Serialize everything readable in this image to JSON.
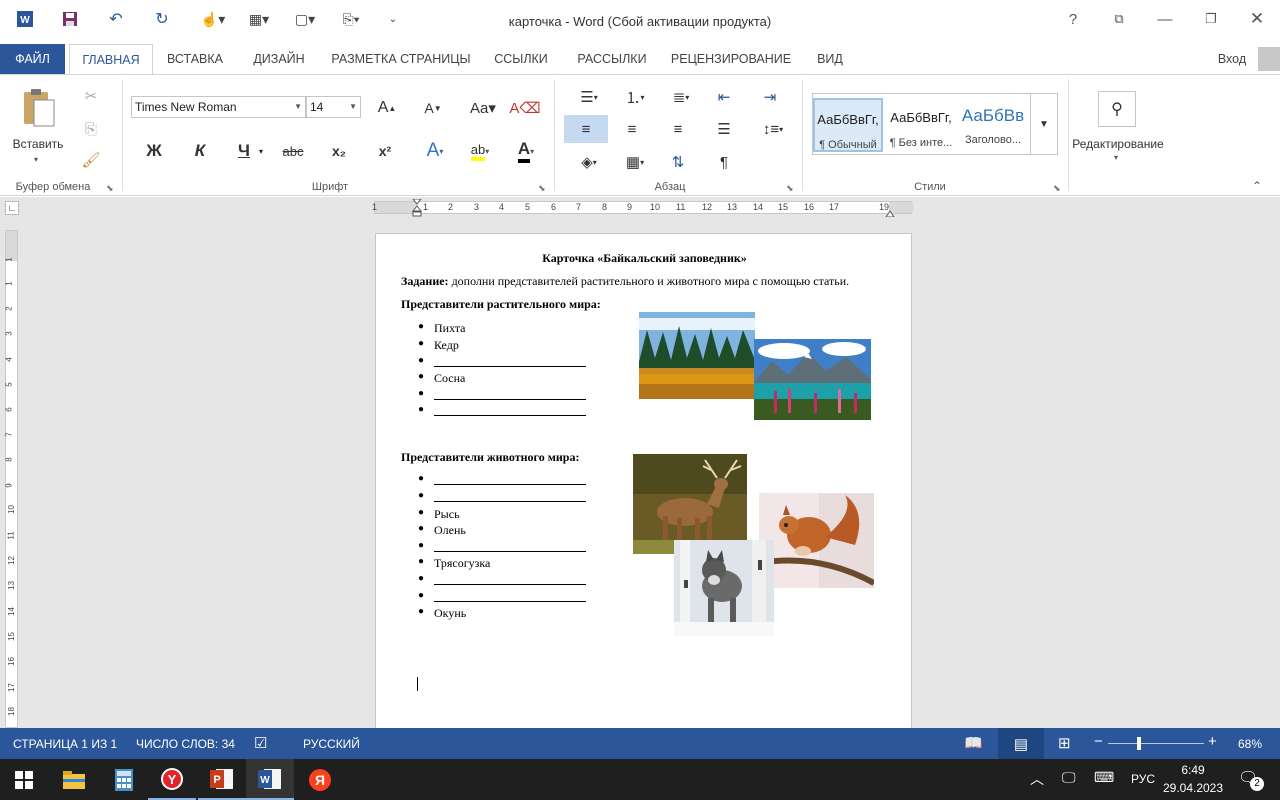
{
  "window": {
    "title": "карточка - Word (Сбой активации продукта)",
    "help": "?"
  },
  "tabs": {
    "file": "ФАЙЛ",
    "home": "ГЛАВНАЯ",
    "insert": "ВСТАВКА",
    "design": "ДИЗАЙН",
    "layout": "РАЗМЕТКА СТРАНИЦЫ",
    "references": "ССЫЛКИ",
    "mailings": "РАССЫЛКИ",
    "review": "РЕЦЕНЗИРОВАНИЕ",
    "view": "ВИД",
    "signin": "Вход"
  },
  "ribbon": {
    "paste_label": "Вставить",
    "clipboard_group": "Буфер обмена",
    "font_name": "Times New Roman",
    "font_size": "14",
    "font_group": "Шрифт",
    "bold": "Ж",
    "italic": "К",
    "underline": "Ч",
    "strike": "abc",
    "subscript": "x₂",
    "superscript": "x²",
    "paragraph_group": "Абзац",
    "styles_group": "Стили",
    "style_sample_1": "АаБбВвГг,",
    "style_name_1": "¶ Обычный",
    "style_sample_2": "АаБбВвГг,",
    "style_name_2": "¶ Без инте...",
    "style_sample_3": "АаБбВв",
    "style_name_3": "Заголово...",
    "editing_label": "Редактирование"
  },
  "ruler": {
    "numbers": [
      "1",
      "1",
      "2",
      "3",
      "4",
      "5",
      "6",
      "7",
      "8",
      "9",
      "10",
      "11",
      "12",
      "13",
      "14",
      "15",
      "16",
      "17",
      "19"
    ],
    "vnumbers": [
      "1",
      "1",
      "2",
      "3",
      "4",
      "5",
      "6",
      "7",
      "8",
      "9",
      "10",
      "11",
      "12",
      "13",
      "14",
      "15",
      "16",
      "17",
      "18"
    ]
  },
  "document": {
    "title": "Карточка «Байкальский заповедник»",
    "task_label": "Задание:",
    "task_text": " дополни представителей растительного и животного мира с помощью статьи.",
    "plants_heading": "Представители растительного мира:",
    "plants": [
      "Пихта",
      "Кедр",
      "",
      "Сосна",
      "",
      ""
    ],
    "animals_heading": "Представители животного мира:",
    "animals": [
      "",
      "",
      "Рысь",
      "Олень",
      "",
      "Трясогузка",
      "",
      "",
      "Окунь"
    ]
  },
  "status": {
    "page": "СТРАНИЦА 1 ИЗ 1",
    "words": "ЧИСЛО СЛОВ: 34",
    "language": "РУССКИЙ",
    "zoom": "68%",
    "zoom_value": 68
  },
  "taskbar": {
    "lang": "РУС",
    "time": "6:49",
    "date": "29.04.2023",
    "notifications": "2"
  },
  "colors": {
    "accent": "#2b579a",
    "taskbar": "#1f1f1f"
  }
}
